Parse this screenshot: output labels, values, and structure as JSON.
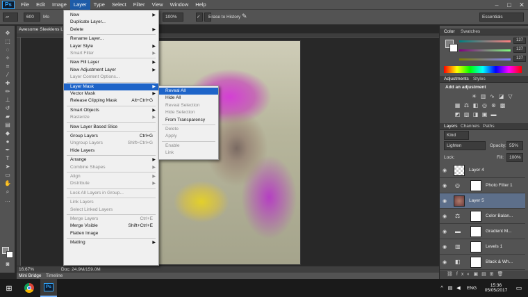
{
  "app": {
    "logo": "Ps"
  },
  "menubar": {
    "items": [
      "File",
      "Edit",
      "Image",
      "Layer",
      "Type",
      "Select",
      "Filter",
      "View",
      "Window",
      "Help"
    ]
  },
  "options_bar": {
    "brush_size": "600",
    "mode_short": "Mo",
    "flow_value": "100%",
    "erase_to_history": "Erase to History",
    "workspace": "Essentials"
  },
  "document": {
    "tab_title": "Awesome Sleeklens L",
    "zoom": "16.67%",
    "doc_size": "Doc: 24.9M/159.0M"
  },
  "bottom_tabs": {
    "mini_bridge": "Mini Bridge",
    "timeline": "Timeline"
  },
  "color_panel": {
    "tabs": [
      "Color",
      "Swatches"
    ],
    "r": "127",
    "g": "127",
    "b": "127"
  },
  "adjustments_panel": {
    "tabs": [
      "Adjustments",
      "Styles"
    ],
    "heading": "Add an adjustment"
  },
  "layers_panel": {
    "tabs": [
      "Layers",
      "Channels",
      "Paths"
    ],
    "kind_filter": "Kind",
    "blend_mode": "Lighten",
    "opacity_label": "Opacity:",
    "opacity_value": "55%",
    "lock_label": "Lock:",
    "fill_label": "Fill:",
    "fill_value": "100%",
    "layers": [
      "Layer 4",
      "Photo Filter 1",
      "Layer 5",
      "Color Balan...",
      "Gradient M...",
      "Levels 1",
      "Black & Wh..."
    ]
  },
  "layer_menu": {
    "items": [
      {
        "label": "New",
        "sub": true
      },
      {
        "label": "Duplicate Layer..."
      },
      {
        "label": "Delete",
        "sub": true
      },
      {
        "label": "Rename Layer..."
      },
      {
        "label": "Layer Style",
        "sub": true
      },
      {
        "label": "Smart Filter",
        "disabled": true,
        "sub": true
      },
      {
        "label": "New Fill Layer",
        "sub": true
      },
      {
        "label": "New Adjustment Layer",
        "sub": true
      },
      {
        "label": "Layer Content Options...",
        "disabled": true
      },
      {
        "label": "Layer Mask",
        "sub": true,
        "highlight": true
      },
      {
        "label": "Vector Mask",
        "sub": true
      },
      {
        "label": "Release Clipping Mask",
        "shortcut": "Alt+Ctrl+G"
      },
      {
        "label": "Smart Objects",
        "sub": true
      },
      {
        "label": "Rasterize",
        "disabled": true,
        "sub": true
      },
      {
        "label": "New Layer Based Slice"
      },
      {
        "label": "Group Layers",
        "shortcut": "Ctrl+G"
      },
      {
        "label": "Ungroup Layers",
        "shortcut": "Shift+Ctrl+G",
        "disabled": true
      },
      {
        "label": "Hide Layers"
      },
      {
        "label": "Arrange",
        "sub": true
      },
      {
        "label": "Combine Shapes",
        "disabled": true,
        "sub": true
      },
      {
        "label": "Align",
        "disabled": true,
        "sub": true
      },
      {
        "label": "Distribute",
        "disabled": true,
        "sub": true
      },
      {
        "label": "Lock All Layers in Group...",
        "disabled": true
      },
      {
        "label": "Link Layers",
        "disabled": true
      },
      {
        "label": "Select Linked Layers",
        "disabled": true
      },
      {
        "label": "Merge Layers",
        "shortcut": "Ctrl+E",
        "disabled": true
      },
      {
        "label": "Merge Visible",
        "shortcut": "Shift+Ctrl+E"
      },
      {
        "label": "Flatten Image"
      },
      {
        "label": "Matting",
        "sub": true
      }
    ]
  },
  "layer_mask_submenu": {
    "items": [
      {
        "label": "Reveal All",
        "highlight": true
      },
      {
        "label": "Hide All"
      },
      {
        "label": "Reveal Selection",
        "disabled": true
      },
      {
        "label": "Hide Selection",
        "disabled": true
      },
      {
        "label": "From Transparency"
      },
      {
        "label": "Delete",
        "disabled": true
      },
      {
        "label": "Apply",
        "disabled": true
      },
      {
        "label": "Enable",
        "disabled": true
      },
      {
        "label": "Link",
        "disabled": true
      }
    ]
  },
  "taskbar": {
    "language": "ENG",
    "time": "15:36",
    "date": "05/05/2017"
  },
  "colors": {
    "accent": "#1e64c8",
    "panel": "#535353",
    "canvas_bg": "#282828"
  }
}
